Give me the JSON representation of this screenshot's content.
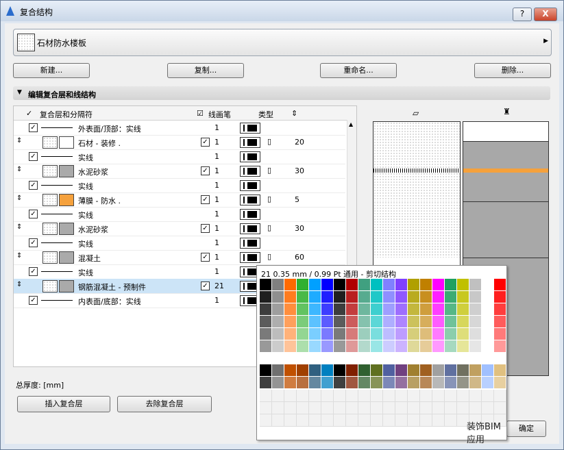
{
  "window": {
    "title": "复合结构",
    "help": "?",
    "close": "X"
  },
  "selector": {
    "label": "石材防水楼板"
  },
  "buttons": {
    "new": "新建...",
    "copy": "复制...",
    "rename": "重命名...",
    "delete": "删除..."
  },
  "section": {
    "label": "编辑复合层和线结构"
  },
  "table": {
    "headers": {
      "layer": "复合层和分隔符",
      "pen": "线画笔",
      "type": "类型"
    },
    "rows": [
      {
        "kind": "line",
        "name": "外表面/顶部：实线",
        "pen": "1"
      },
      {
        "kind": "layer",
        "name": "石材 - 装修 .",
        "pen": "1",
        "thickness": "20",
        "swatch": "#ffffff"
      },
      {
        "kind": "line",
        "name": "实线",
        "pen": "1"
      },
      {
        "kind": "layer",
        "name": "水泥砂浆",
        "pen": "1",
        "thickness": "30",
        "swatch": "#aaaaaa"
      },
      {
        "kind": "line",
        "name": "实线",
        "pen": "1"
      },
      {
        "kind": "layer",
        "name": "薄膜 - 防水 .",
        "pen": "1",
        "thickness": "5",
        "swatch": "#f5a13c"
      },
      {
        "kind": "line",
        "name": "实线",
        "pen": "1"
      },
      {
        "kind": "layer",
        "name": "水泥砂浆",
        "pen": "1",
        "thickness": "30",
        "swatch": "#aaaaaa"
      },
      {
        "kind": "line",
        "name": "实线",
        "pen": "1"
      },
      {
        "kind": "layer",
        "name": "混凝土",
        "pen": "1",
        "thickness": "60",
        "swatch": "#aaaaaa"
      },
      {
        "kind": "line",
        "name": "实线",
        "pen": "1"
      },
      {
        "kind": "layer",
        "name": "钢筋混凝土 - 预制件",
        "pen": "21",
        "thickness": "",
        "swatch": "#aaaaaa",
        "selected": true
      },
      {
        "kind": "line",
        "name": "内表面/底部：实线",
        "pen": "1"
      }
    ]
  },
  "total_label": "总厚度: [mm]",
  "bottom_buttons": {
    "insert": "插入复合层",
    "remove": "去除复合层",
    "ok": "确定"
  },
  "palette": {
    "header": "21 0.35 mm / 0.99 Pt 通用 - 剪切结构",
    "colors_top": [
      "#000000",
      "#808080",
      "#ff6a00",
      "#30b030",
      "#00a0ff",
      "#0000ff",
      "#000000",
      "#b00000",
      "#40a080",
      "#00c0c0",
      "#8080ff",
      "#8040ff",
      "#b0a000",
      "#c08000",
      "#ff00ff",
      "#20a060",
      "#c0c000",
      "#c0c0c0",
      "#ffffff",
      "#ff0000"
    ],
    "colors_bottom": [
      "#000000",
      "#707070",
      "#c05000",
      "#a04000",
      "#306080",
      "#0080c0",
      "#000000",
      "#802000",
      "#306030",
      "#607020",
      "#5060a0",
      "#704080",
      "#a08030",
      "#a06020",
      "#a0a0a0",
      "#6070a0",
      "#707060",
      "#c0a060",
      "#a0c0ff",
      "#e0c080"
    ],
    "watermark": "装饰BIM应用"
  }
}
